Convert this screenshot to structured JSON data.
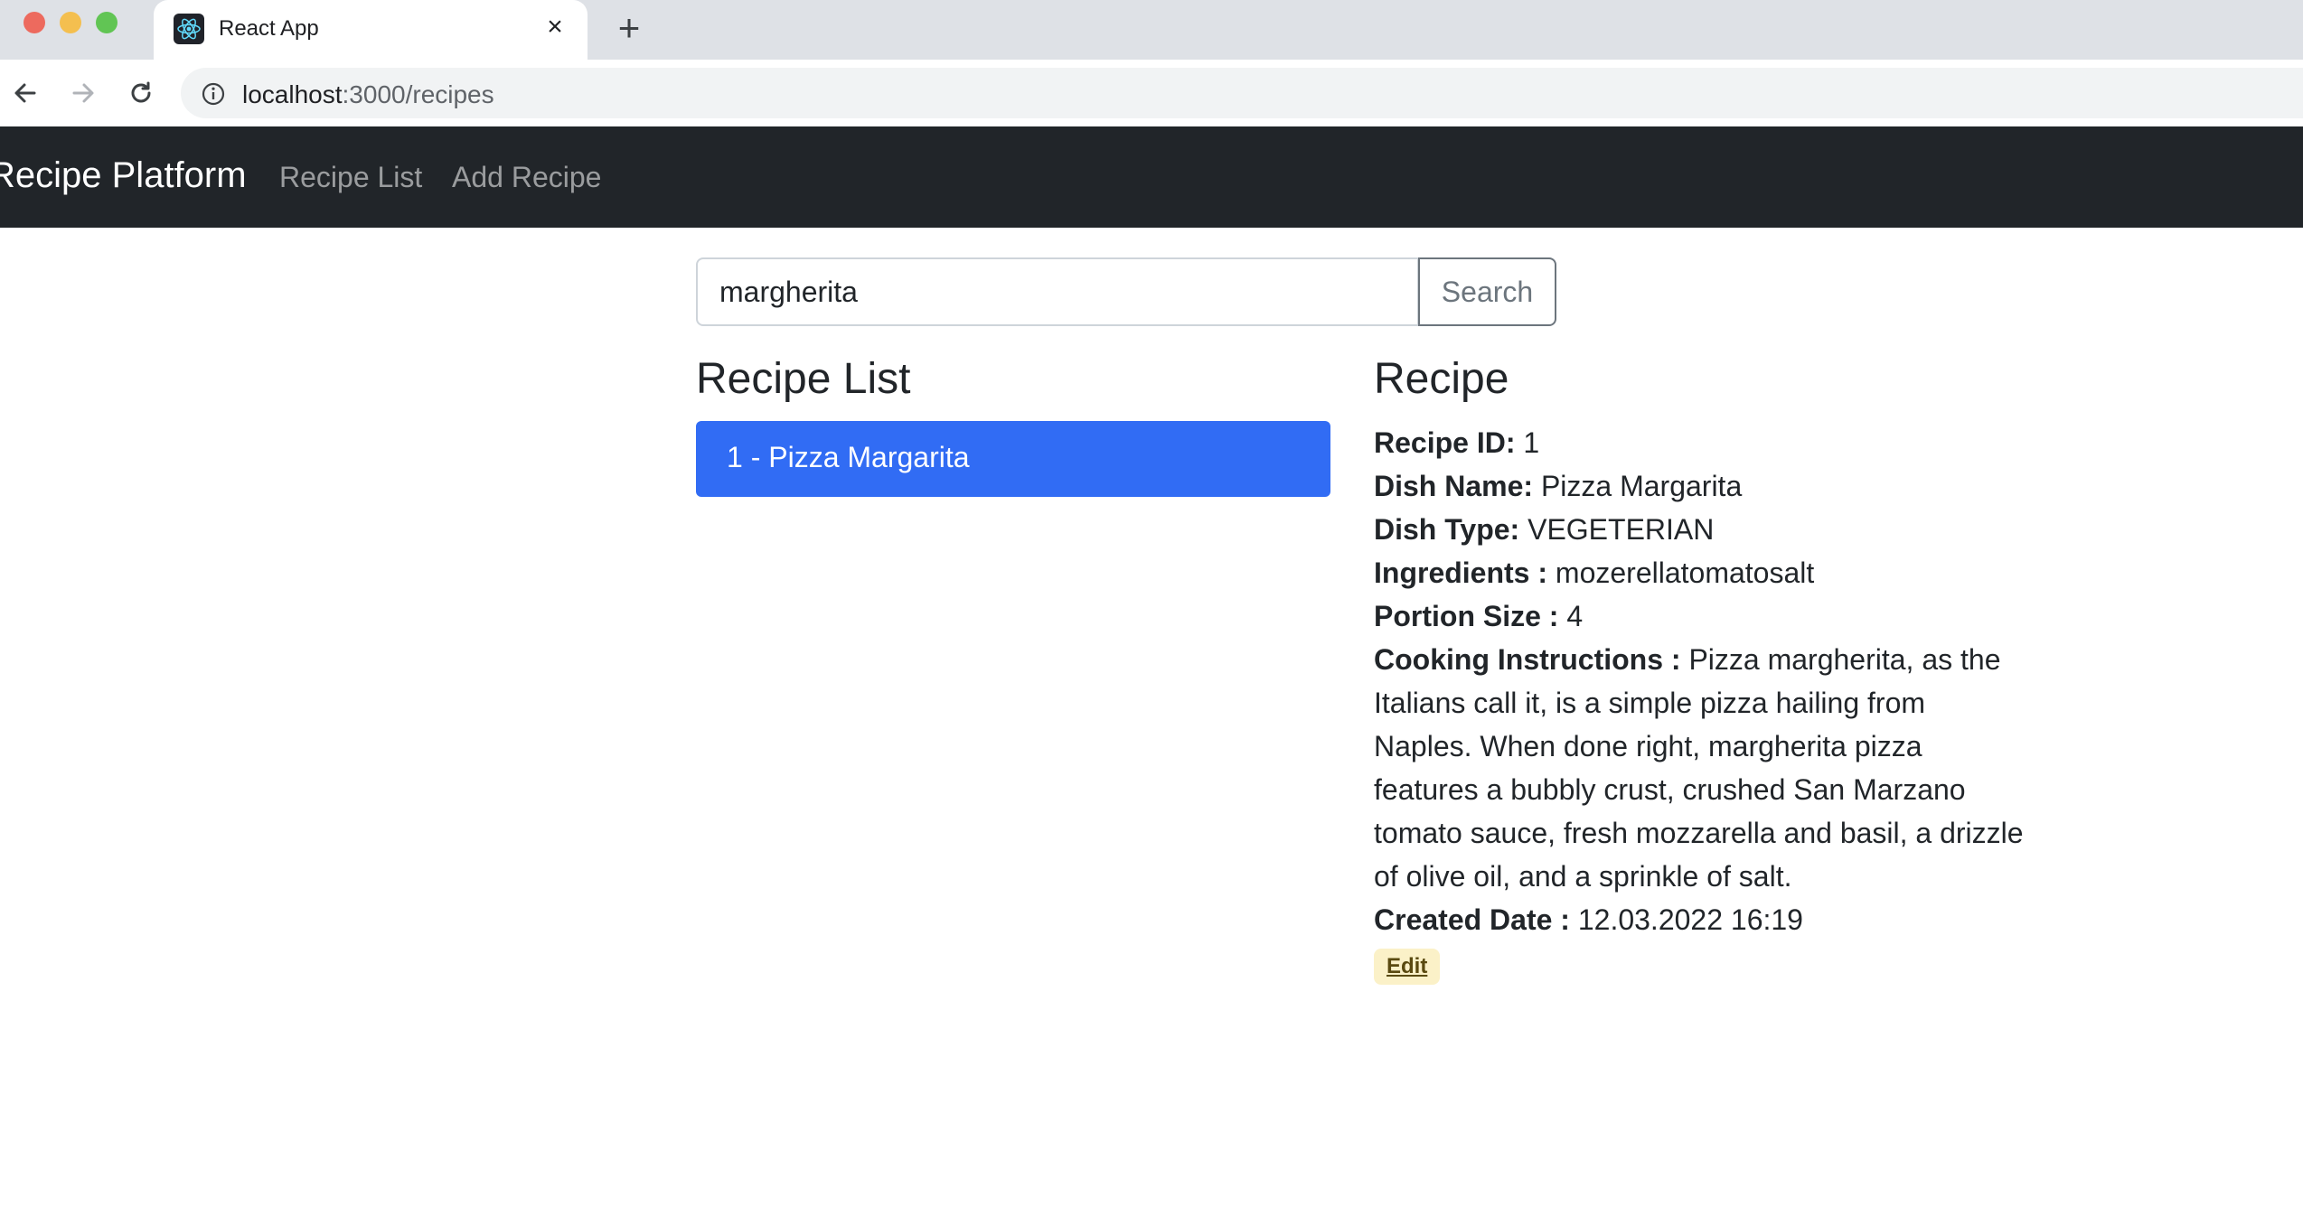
{
  "browser": {
    "tab_title": "React App",
    "url_host": "localhost",
    "url_path": ":3000/recipes"
  },
  "navbar": {
    "brand": "Recipe Platform",
    "links": [
      "Recipe List",
      "Add Recipe"
    ],
    "background": "#212529"
  },
  "search": {
    "value": "margherita",
    "button_label": "Search"
  },
  "recipe_list": {
    "heading": "Recipe List",
    "items": [
      "1 - Pizza Margarita"
    ],
    "active_color": "#316cf4"
  },
  "recipe": {
    "heading": "Recipe",
    "id_label": "Recipe ID:",
    "id_value": "1",
    "name_label": "Dish Name:",
    "name_value": "Pizza Margarita",
    "type_label": "Dish Type:",
    "type_value": "VEGETERIAN",
    "ingredients_label": "Ingredients :",
    "ingredients_value": "mozerellatomatosalt",
    "portion_label": "Portion Size :",
    "portion_value": "4",
    "instructions_label": "Cooking Instructions :",
    "instructions_value": "Pizza margherita, as the Italians call it, is a simple pizza hailing from Naples. When done right, margherita pizza features a bubbly crust, crushed San Marzano tomato sauce, fresh mozzarella and basil, a drizzle of olive oil, and a sprinkle of salt.",
    "created_label": "Created Date :",
    "created_value": "12.03.2022 16:19",
    "edit_label": "Edit"
  }
}
